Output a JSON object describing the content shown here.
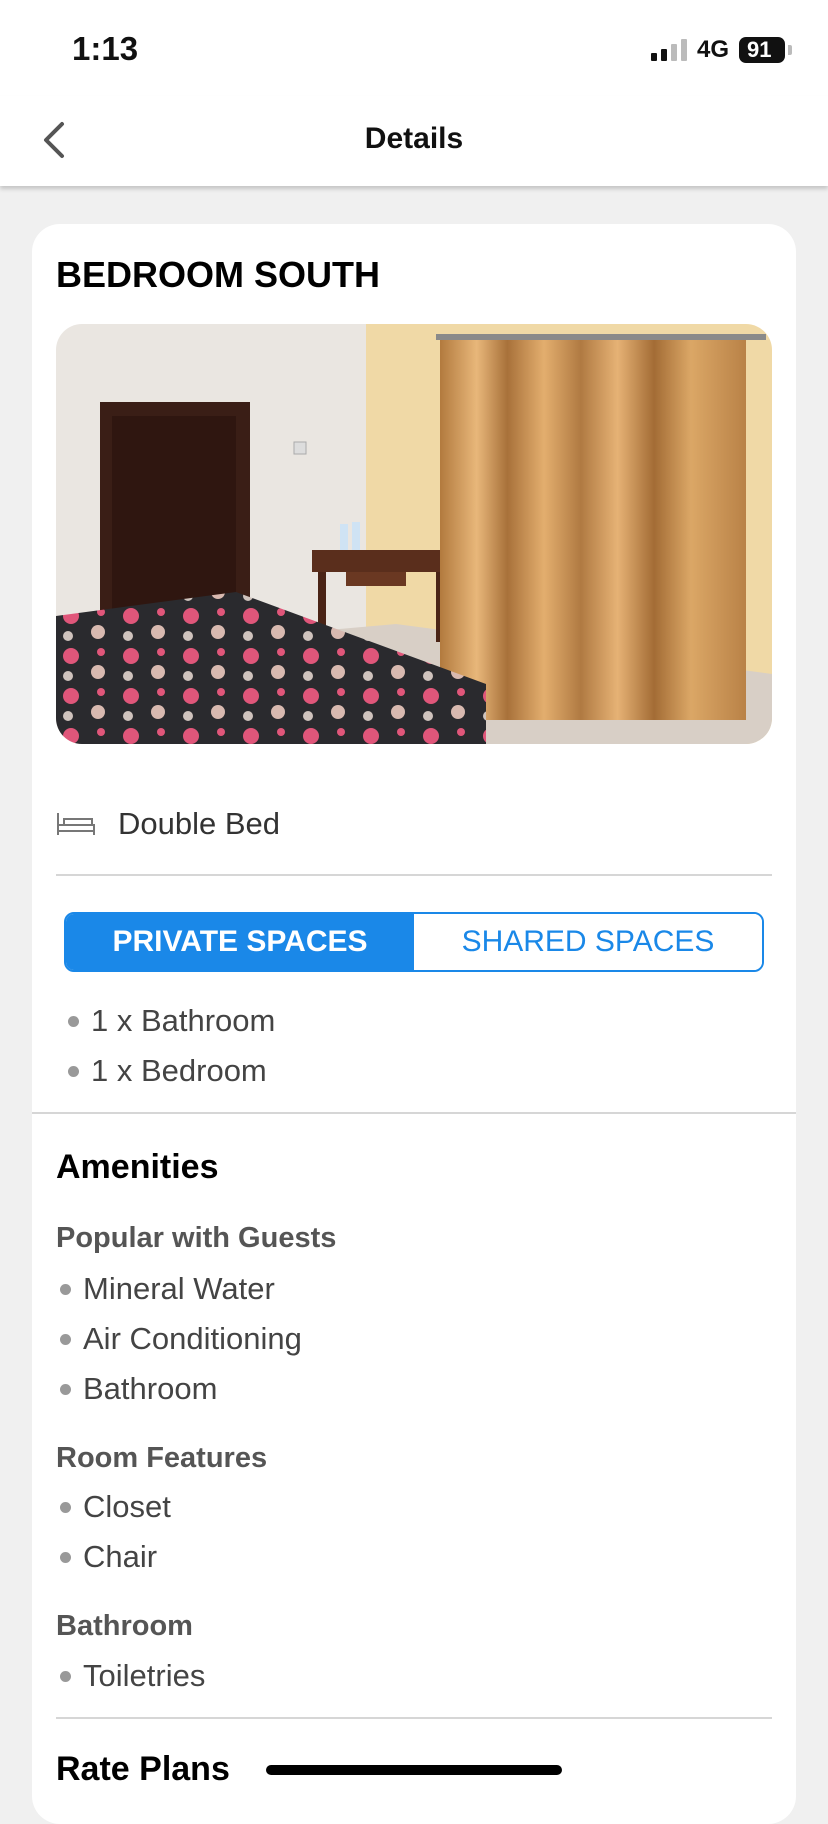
{
  "status_bar": {
    "time": "1:13",
    "network": "4G",
    "battery": "91"
  },
  "nav": {
    "title": "Details"
  },
  "room": {
    "title": "BEDROOM SOUTH",
    "bed_type": "Double Bed"
  },
  "carousel": {
    "total": 2,
    "active_index": 0
  },
  "tabs": {
    "private_label": "PRIVATE SPACES",
    "shared_label": "SHARED SPACES",
    "selected": "private"
  },
  "private_spaces": [
    "1 x Bathroom",
    "1 x Bedroom"
  ],
  "amenities": {
    "heading": "Amenities",
    "groups": [
      {
        "title": "Popular with Guests",
        "items": [
          "Mineral Water",
          "Air Conditioning",
          "Bathroom"
        ]
      },
      {
        "title": "Room Features",
        "items": [
          "Closet",
          "Chair"
        ]
      },
      {
        "title": "Bathroom",
        "items": [
          "Toiletries"
        ]
      }
    ]
  },
  "rate_plans": {
    "heading": "Rate Plans"
  },
  "colors": {
    "accent": "#1a88e8",
    "card_bg": "#ffffff",
    "page_bg": "#f0f0f0"
  }
}
